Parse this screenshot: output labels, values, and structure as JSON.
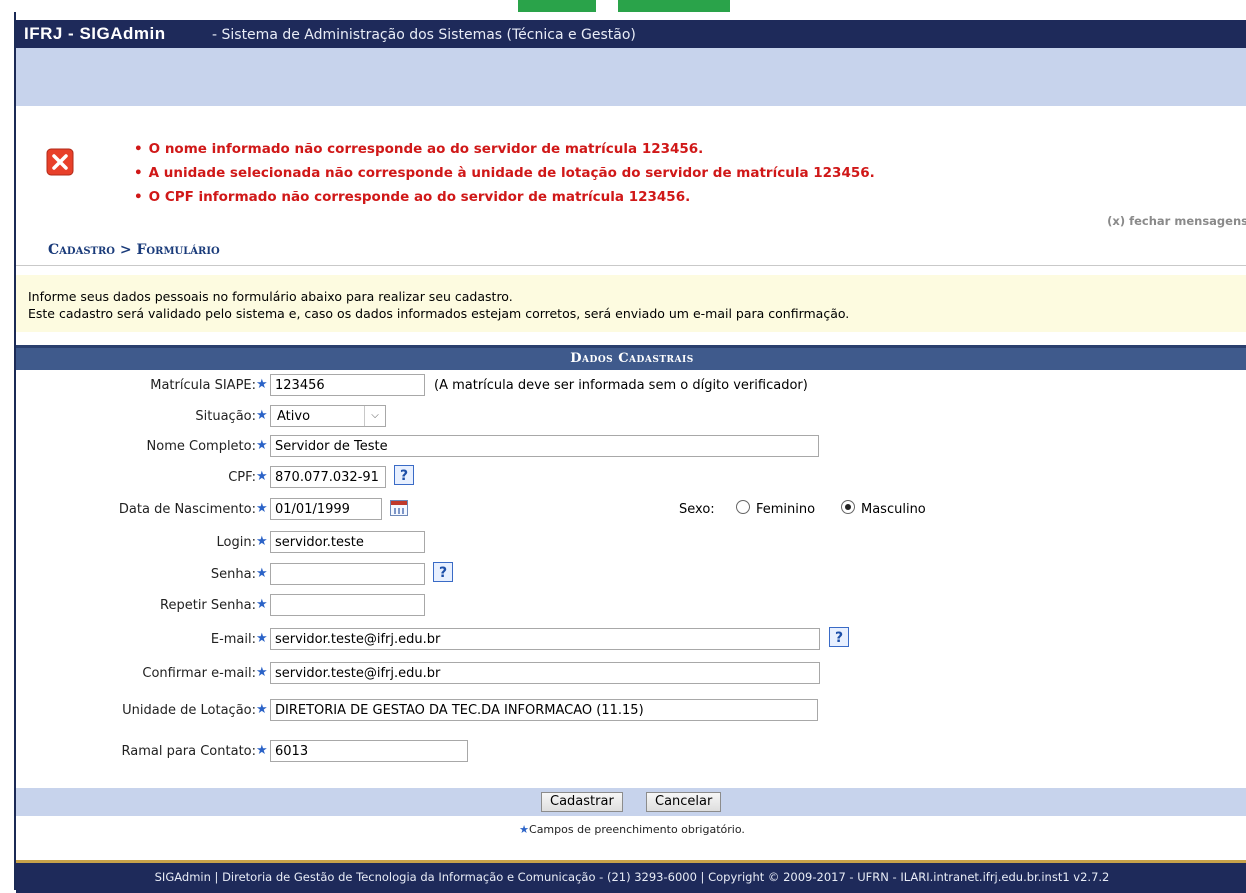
{
  "header": {
    "system": "IFRJ - SIGAdmin",
    "description": "- Sistema de Administração dos Sistemas (Técnica e Gestão)"
  },
  "errors": {
    "items": [
      "O nome informado não corresponde ao do servidor de matrícula 123456.",
      "A unidade selecionada não corresponde à unidade de lotação do servidor de matrícula 123456.",
      "O CPF informado não corresponde ao do servidor de matrícula 123456."
    ],
    "close_label": "(x) fechar mensagens"
  },
  "breadcrumb": "Cadastro > Formulário",
  "info": {
    "line1": "Informe seus dados pessoais no formulário abaixo para realizar seu cadastro.",
    "line2": "Este cadastro será validado pelo sistema e, caso os dados informados estejam corretos, será enviado um e-mail para confirmação."
  },
  "form": {
    "title": "Dados Cadastrais",
    "matricula": {
      "label": "Matrícula SIAPE:",
      "value": "123456",
      "note": "(A matrícula deve ser informada sem o dígito verificador)"
    },
    "situacao": {
      "label": "Situação:",
      "value": "Ativo"
    },
    "nome": {
      "label": "Nome Completo:",
      "value": "Servidor de Teste"
    },
    "cpf": {
      "label": "CPF:",
      "value": "870.077.032-91"
    },
    "nascimento": {
      "label": "Data de Nascimento:",
      "value": "01/01/1999"
    },
    "sexo": {
      "label": "Sexo:",
      "options": [
        "Feminino",
        "Masculino"
      ],
      "selected": "Masculino"
    },
    "login": {
      "label": "Login:",
      "value": "servidor.teste"
    },
    "senha": {
      "label": "Senha:",
      "value": ""
    },
    "repetir_senha": {
      "label": "Repetir Senha:",
      "value": ""
    },
    "email": {
      "label": "E-mail:",
      "value": "servidor.teste@ifrj.edu.br"
    },
    "confirmar_email": {
      "label": "Confirmar e-mail:",
      "value": "servidor.teste@ifrj.edu.br"
    },
    "unidade": {
      "label": "Unidade de Lotação:",
      "value": "DIRETORIA DE GESTAO DA TEC.DA INFORMACAO (11.15)"
    },
    "ramal": {
      "label": "Ramal para Contato:",
      "value": "6013"
    },
    "help_glyph": "?",
    "required_star": "★",
    "buttons": {
      "submit": "Cadastrar",
      "cancel": "Cancelar"
    },
    "required_note": "Campos de preenchimento obrigatório."
  },
  "footer": "SIGAdmin | Diretoria de Gestão de Tecnologia da Informação e Comunicação - (21) 3293-6000 | Copyright © 2009-2017 - UFRN - ILARI.intranet.ifrj.edu.br.inst1 v2.7.2",
  "colors": {
    "header": "#1e2a5a",
    "band": "#c7d3ec",
    "error": "#d01818",
    "section_header": "#3f5a8c",
    "info_bg": "#fdfbe0",
    "required_star": "#2b63c7"
  },
  "icons": {
    "error": "error-x-icon",
    "help": "help-icon",
    "calendar": "calendar-icon",
    "dropdown": "chevron-down-icon"
  }
}
